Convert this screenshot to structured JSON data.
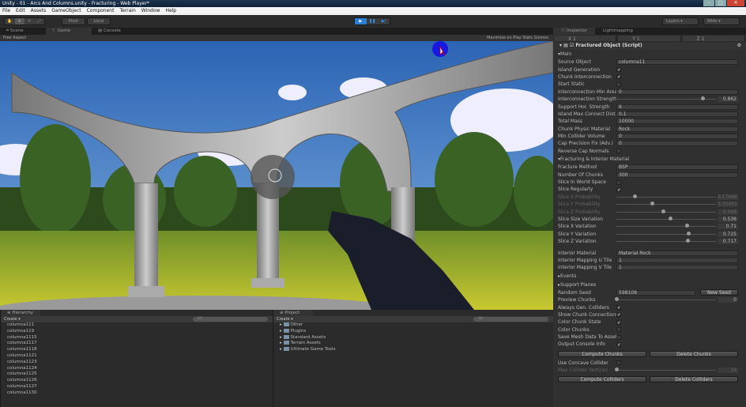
{
  "window": {
    "title": "Unity - 01 - Arcs And Columns.unity - Fracturing - Web Player*"
  },
  "menu": [
    "File",
    "Edit",
    "Assets",
    "GameObject",
    "Component",
    "Terrain",
    "Window",
    "Help"
  ],
  "toolbar": {
    "pivot": "Pivot",
    "local": "Local",
    "layers": "Layers",
    "layout": "Wide"
  },
  "tabs": [
    "Scene",
    "Game",
    "Console"
  ],
  "game": {
    "aspect": "Free Aspect",
    "right": "Maximize on Play   Stats   Gizmos"
  },
  "inspector": {
    "tabs": [
      "Inspector",
      "Lightmapping"
    ],
    "xyz": [
      "X  1",
      "Y  1",
      "Z  1"
    ],
    "component": "Fractured Object (Script)",
    "rows": [
      {
        "t": "sect",
        "label": "Main"
      },
      {
        "t": "field",
        "label": "Source Object",
        "value": "columna11"
      },
      {
        "t": "check",
        "label": "Island Generation",
        "value": true
      },
      {
        "t": "check",
        "label": "Chunk Interconnection",
        "value": true
      },
      {
        "t": "check",
        "label": "Start Static",
        "value": false
      },
      {
        "t": "field",
        "label": "Interconnection Min Area",
        "value": "0"
      },
      {
        "t": "slider",
        "label": "Interconnection Strength",
        "value": "0.862",
        "frac": 0.862
      },
      {
        "t": "field",
        "label": "Support Hor. Strength",
        "value": "6"
      },
      {
        "t": "field",
        "label": "Island Max Connect Dist.",
        "value": "0.1"
      },
      {
        "t": "field",
        "label": "Total Mass",
        "value": "10000"
      },
      {
        "t": "field",
        "label": "Chunk Physic Material",
        "value": "Rock"
      },
      {
        "t": "field",
        "label": "Min Collider Volume",
        "value": "0"
      },
      {
        "t": "field",
        "label": "Cap Precision Fix (Adv.)",
        "value": "0"
      },
      {
        "t": "check",
        "label": "Reverse Cap Normals",
        "value": false
      },
      {
        "t": "sect",
        "label": "Fracturing & Interior Material"
      },
      {
        "t": "field",
        "label": "Fracture Method",
        "value": "BSP"
      },
      {
        "t": "field",
        "label": "Number Of Chunks",
        "value": "300"
      },
      {
        "t": "check",
        "label": "Slice In World Space",
        "value": false
      },
      {
        "t": "check",
        "label": "Slice Regularly",
        "value": true
      },
      {
        "t": "slider",
        "label": "Slice X Probability",
        "value": "0.17686",
        "frac": 0.18,
        "dim": true
      },
      {
        "t": "slider",
        "label": "Slice Y Probability",
        "value": "0.35401",
        "frac": 0.354,
        "dim": true
      },
      {
        "t": "slider",
        "label": "Slice Z Probability",
        "value": "0.469",
        "frac": 0.469,
        "dim": true
      },
      {
        "t": "slider",
        "label": "Slice Size Variation",
        "value": "0.536",
        "frac": 0.536
      },
      {
        "t": "slider",
        "label": "Slice X Variation",
        "value": "0.71",
        "frac": 0.71
      },
      {
        "t": "slider",
        "label": "Slice Y Variation",
        "value": "0.725",
        "frac": 0.725
      },
      {
        "t": "slider",
        "label": "Slice Z Variation",
        "value": "0.717",
        "frac": 0.717
      },
      {
        "t": "gap"
      },
      {
        "t": "field",
        "label": "Interior Material",
        "value": "Material Rock"
      },
      {
        "t": "field",
        "label": "Interior Mapping U Tile",
        "value": "1"
      },
      {
        "t": "field",
        "label": "Interior Mapping V Tile",
        "value": "1"
      },
      {
        "t": "sect",
        "label": "Events",
        "collapsed": true
      },
      {
        "t": "sect",
        "label": "Support Planes",
        "collapsed": true
      },
      {
        "t": "seed",
        "label": "Random Seed",
        "value": "598108",
        "button": "New Seed"
      },
      {
        "t": "slider",
        "label": "Preview Chunks",
        "value": "0",
        "frac": 0
      },
      {
        "t": "check",
        "label": "Always Gen. Colliders",
        "value": true
      },
      {
        "t": "check",
        "label": "Show Chunk Connections",
        "value": true
      },
      {
        "t": "check",
        "label": "Color Chunk State",
        "value": true
      },
      {
        "t": "check",
        "label": "Color Chunks",
        "value": false
      },
      {
        "t": "check",
        "label": "Save Mesh Data To Asset",
        "value": false
      },
      {
        "t": "check",
        "label": "Output Console Info",
        "value": true
      },
      {
        "t": "buttons",
        "labels": [
          "Compute Chunks",
          "Delete Chunks"
        ]
      },
      {
        "t": "check",
        "label": "Use Concave Collider",
        "value": false
      },
      {
        "t": "slider",
        "label": "Max Collider Vertices",
        "value": "16",
        "frac": 0,
        "dim": true
      },
      {
        "t": "buttons",
        "labels": [
          "Compute Colliders",
          "Delete Colliders"
        ]
      }
    ]
  },
  "hierarchy": {
    "tab": "Hierarchy",
    "create": "Create",
    "search": "All",
    "items": [
      "columna111",
      "columna119",
      "columna1115",
      "columna1117",
      "columna1118",
      "columna1121",
      "columna1123",
      "columna1124",
      "columna1125",
      "columna1126",
      "columna1127",
      "columna1130"
    ]
  },
  "project": {
    "tab": "Project",
    "create": "Create",
    "search": "All",
    "items": [
      "Other",
      "Plugins",
      "Standard Assets",
      "Terrain Assets",
      "Ultimate Game Tools"
    ]
  },
  "colors": {
    "play_active": "#2a7fd4",
    "close": "#cc4433",
    "sky": "#3d78c4"
  }
}
